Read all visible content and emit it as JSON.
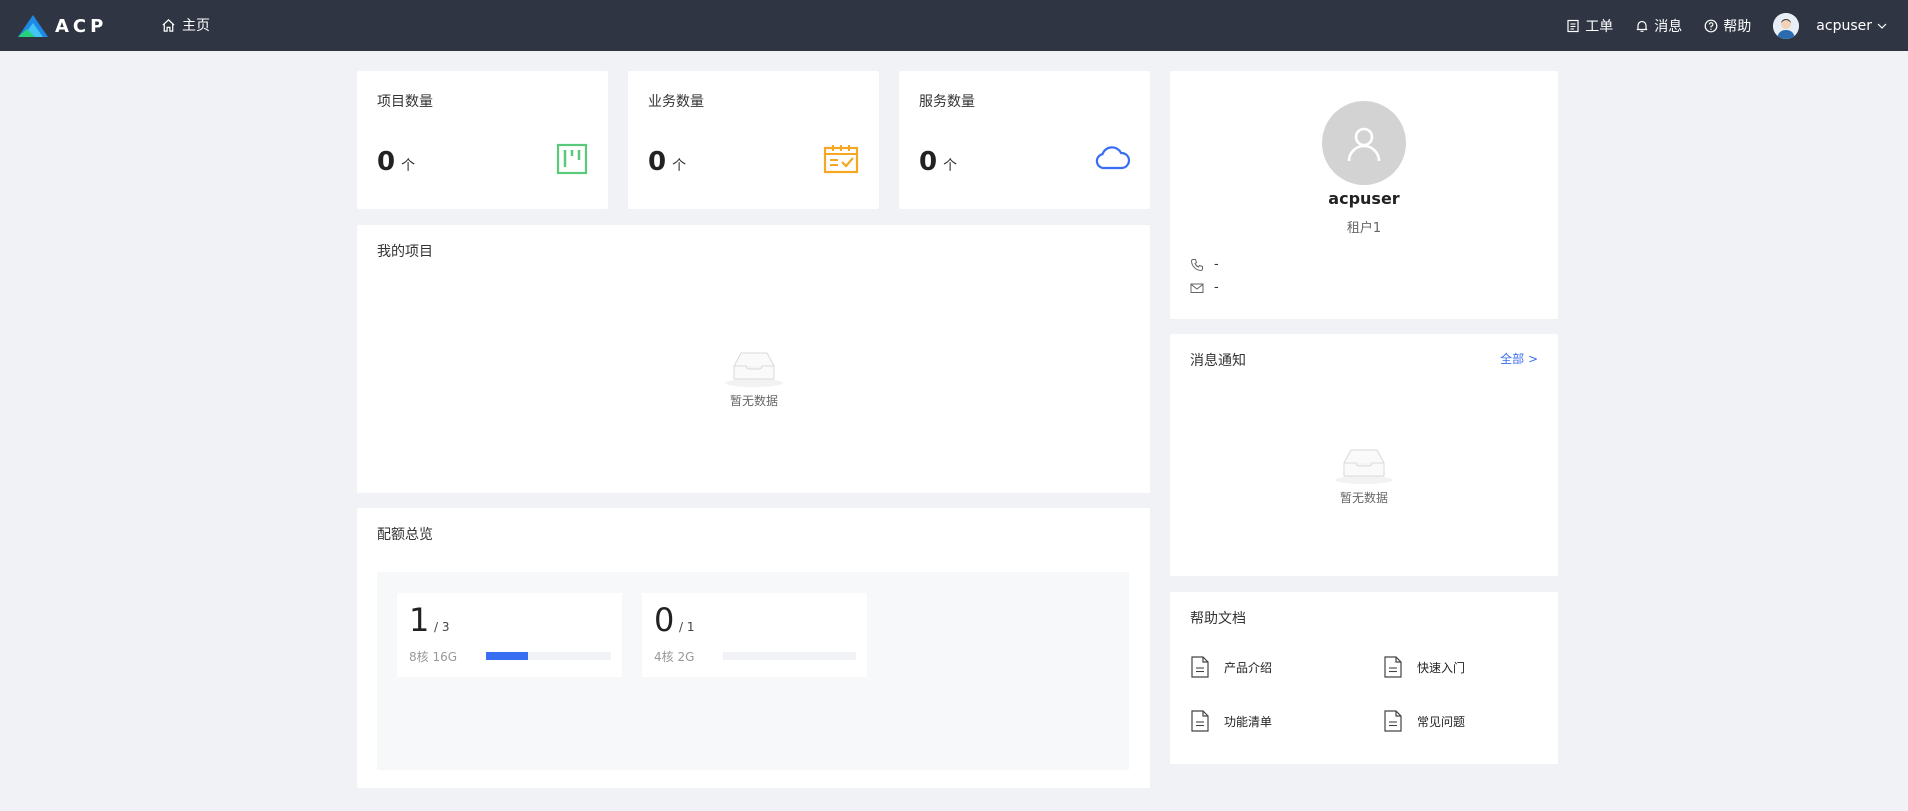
{
  "header": {
    "logo_text": "ACP",
    "nav_home": "主页",
    "ticket": "工单",
    "messages": "消息",
    "help": "帮助",
    "username": "acpuser"
  },
  "stats": [
    {
      "title": "项目数量",
      "value": "0",
      "unit": "个",
      "icon": "project-board-icon",
      "color": "#5bc97a"
    },
    {
      "title": "业务数量",
      "value": "0",
      "unit": "个",
      "icon": "calendar-check-icon",
      "color": "#f5a623"
    },
    {
      "title": "服务数量",
      "value": "0",
      "unit": "个",
      "icon": "cloud-icon",
      "color": "#3a6ef2"
    }
  ],
  "my_projects": {
    "title": "我的项目",
    "empty_text": "暂无数据"
  },
  "quota": {
    "title": "配额总览",
    "items": [
      {
        "used": "1",
        "total": "/ 3",
        "spec": "8核 16G",
        "progress": 0.333
      },
      {
        "used": "0",
        "total": "/ 1",
        "spec": "4核 2G",
        "progress": 0
      }
    ]
  },
  "profile": {
    "name": "acpuser",
    "tenant": "租户1",
    "phone": "-",
    "email": "-"
  },
  "notifications": {
    "title": "消息通知",
    "all_link": "全部 >",
    "empty_text": "暂无数据"
  },
  "help_docs": {
    "title": "帮助文档",
    "items": [
      "产品介绍",
      "快速入门",
      "功能清单",
      "常见问题"
    ]
  },
  "colors": {
    "topbar": "#2f3542",
    "accent": "#3a6ef2",
    "background": "#f0f2f5"
  }
}
